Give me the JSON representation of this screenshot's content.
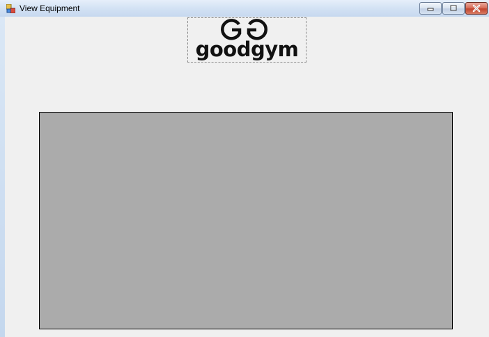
{
  "window": {
    "title": "View Equipment",
    "app_icon": "windows-form-icon",
    "buttons": {
      "minimize_icon": "minimize-icon",
      "maximize_icon": "maximize-icon",
      "close_icon": "close-icon"
    }
  },
  "logo": {
    "brand": "goodgym",
    "mark": "GG"
  },
  "colors": {
    "client_background": "#f0f0f0",
    "grid_background": "#ababab",
    "close_button": "#c2452f"
  }
}
